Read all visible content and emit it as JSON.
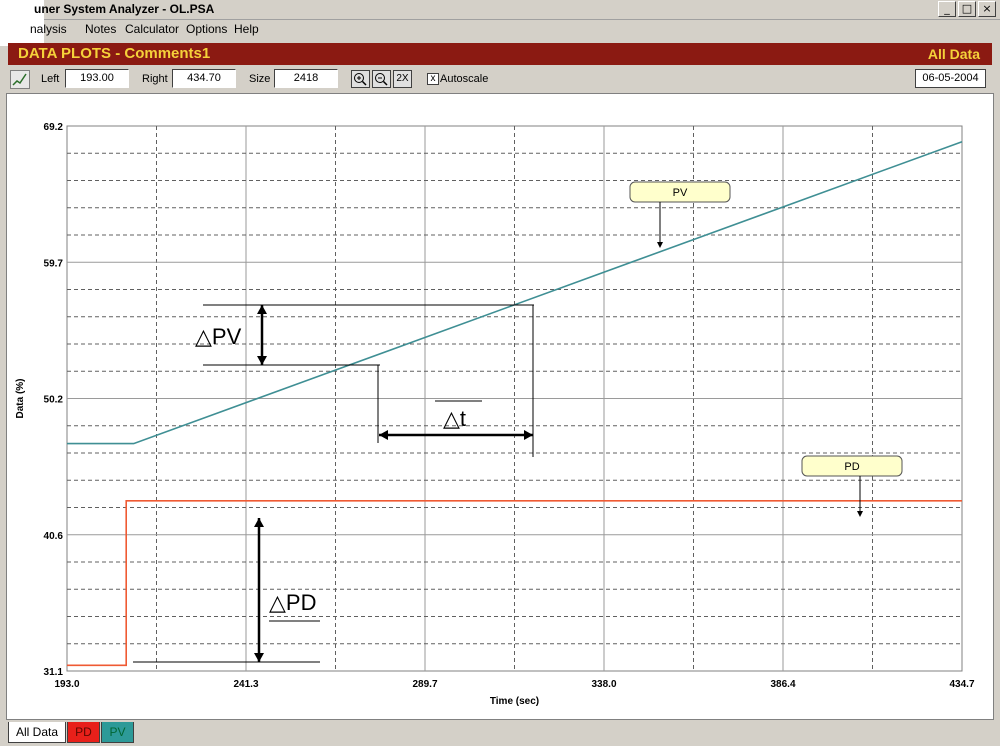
{
  "window": {
    "title": "uner System Analyzer - OL.PSA",
    "min_icon": "_",
    "max_icon": "□",
    "close_icon": "×"
  },
  "menu": [
    "nalysis",
    "Notes",
    "Calculator",
    "Options",
    "Help"
  ],
  "header": {
    "title": "DATA PLOTS - Comments1",
    "right": "All Data"
  },
  "toolbar": {
    "left_label": "Left",
    "left_value": "193.00",
    "right_label": "Right",
    "right_value": "434.70",
    "size_label": "Size",
    "size_value": "2418",
    "zoom_2x": "2X",
    "autoscale_label": "Autoscale",
    "autoscale_checked": "x",
    "date": "06-05-2004"
  },
  "chart_data": {
    "type": "line",
    "xlabel": "Time (sec)",
    "ylabel": "Data (%)",
    "xlim": [
      193.0,
      434.7
    ],
    "ylim": [
      31.1,
      69.2
    ],
    "x_ticks": [
      "193.0",
      "241.3",
      "289.7",
      "338.0",
      "386.4",
      "434.7"
    ],
    "y_ticks": [
      "69.2",
      "59.7",
      "50.2",
      "40.6",
      "31.1"
    ],
    "grid": true,
    "series": [
      {
        "name": "PV",
        "color": "#3f8f94",
        "x": [
          193.0,
          211.0,
          434.7
        ],
        "y": [
          47.0,
          47.0,
          68.1
        ]
      },
      {
        "name": "PD",
        "color": "#ef5a33",
        "x": [
          193.0,
          209.0,
          209.0,
          434.7
        ],
        "y": [
          31.5,
          31.5,
          43.0,
          43.0
        ]
      }
    ],
    "annotations": {
      "delta_pv": "△PV",
      "delta_t": "△t",
      "delta_pd": "△PD"
    }
  },
  "tabs": [
    "All Data",
    "PD",
    "PV"
  ]
}
